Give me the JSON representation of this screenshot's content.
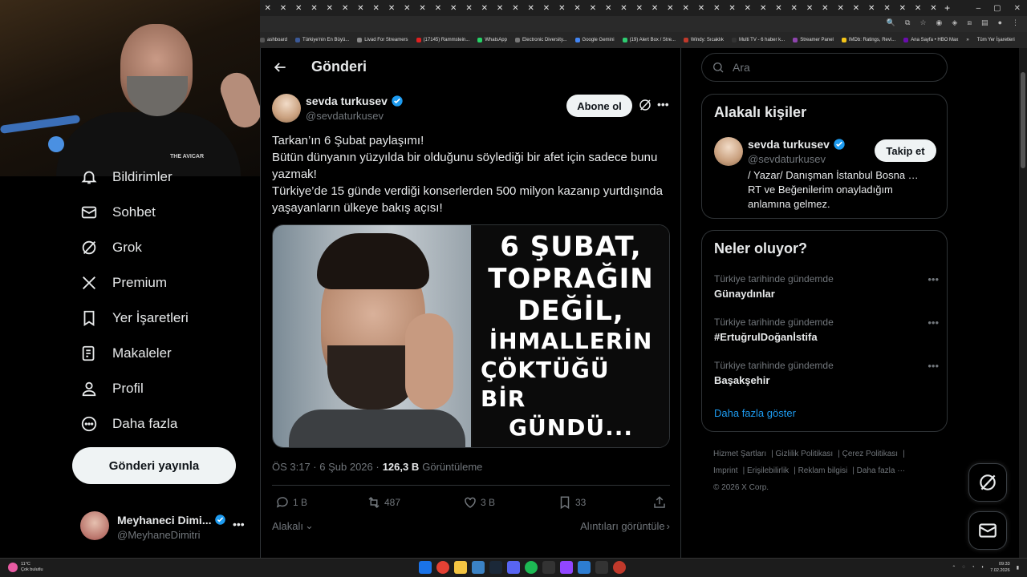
{
  "browser": {
    "bookmarks": [
      {
        "label": "ashboard",
        "color": "#555555"
      },
      {
        "label": "Türkiye'nin En Büyü...",
        "color": "#3b5998"
      },
      {
        "label": "Livad For Streamers",
        "color": "#888888"
      },
      {
        "label": "(17145) Rammstein...",
        "color": "#e02020"
      },
      {
        "label": "WhatsApp",
        "color": "#25d366"
      },
      {
        "label": "Electronic Diversity...",
        "color": "#777777"
      },
      {
        "label": "Google Gemini",
        "color": "#4285f4"
      },
      {
        "label": "(19) Alert Box / Stre...",
        "color": "#2ecc71"
      },
      {
        "label": "Windy: Sıcaklık",
        "color": "#c0392b"
      },
      {
        "label": "Multi TV - 6 haber k...",
        "color": "#333333"
      },
      {
        "label": "Streamer Panel",
        "color": "#8e44ad"
      },
      {
        "label": "IMDb: Ratings, Revi...",
        "color": "#f5c518"
      },
      {
        "label": "Ana Sayfa • HBO Max",
        "color": "#6a0dad"
      }
    ],
    "bookmarks_overflow": "»",
    "all_bookmarks": "Tüm Yer İşaretleri"
  },
  "webcam": {
    "logo_text": "THE AVICAR"
  },
  "sidebar": {
    "items": [
      {
        "label": "Bildirimler",
        "icon": "bell-icon"
      },
      {
        "label": "Sohbet",
        "icon": "mail-icon"
      },
      {
        "label": "Grok",
        "icon": "grok-icon"
      },
      {
        "label": "Premium",
        "icon": "x-logo-icon"
      },
      {
        "label": "Yer İşaretleri",
        "icon": "bookmark-icon"
      },
      {
        "label": "Makaleler",
        "icon": "article-icon"
      },
      {
        "label": "Profil",
        "icon": "person-icon"
      },
      {
        "label": "Daha fazla",
        "icon": "more-circle-icon"
      }
    ],
    "post_button": "Gönderi yayınla",
    "account": {
      "name": "Meyhaneci Dimi...",
      "handle": "@MeyhaneDimitri"
    }
  },
  "main": {
    "title": "Gönderi",
    "author": {
      "name": "sevda turkusev",
      "handle": "@sevdaturkusev"
    },
    "subscribe": "Abone ol",
    "text": [
      "Tarkan’ın 6 Şubat paylaşımı!",
      "Bütün dünyanın yüzyılda bir olduğunu söylediği bir afet için sadece bunu yazmak!",
      "Türkiye’de 15 günde verdiği konserlerden 500 milyon kazanıp yurtdışında yaşayanların ülkeye bakış açısı!"
    ],
    "media_art": [
      "6 ŞUBAT,",
      "TOPRAĞIN",
      "DEĞİL,",
      "İHMALLERİN",
      "ÇÖKTÜĞÜ BİR",
      "GÜNDÜ..."
    ],
    "time": "ÖS 3:17 · 6 Şub 2026 ·",
    "views": "126,3 B",
    "views_label": "Görüntüleme",
    "actions": {
      "replies": "1 B",
      "reposts": "487",
      "likes": "3 B",
      "bookmarks": "33"
    },
    "relevant": "Alakalı",
    "quotes": "Alıntıları görüntüle"
  },
  "right": {
    "search_placeholder": "Ara",
    "related_title": "Alakalı kişiler",
    "related": {
      "name": "sevda turkusev",
      "handle": "@sevdaturkusev",
      "follow": "Takip et",
      "bio": "/ Yazar/ Danışman İstanbul Bosna … RT ve Beğenilerim onayladığım anlamına gelmez."
    },
    "trends_title": "Neler oluyor?",
    "trends": [
      {
        "context": "Türkiye tarihinde gündemde",
        "name": "Günaydınlar"
      },
      {
        "context": "Türkiye tarihinde gündemde",
        "name": "#ErtuğrulDoğanİstifa"
      },
      {
        "context": "Türkiye tarihinde gündemde",
        "name": "Başakşehir"
      }
    ],
    "show_more": "Daha fazla göster",
    "legal": [
      "Hizmet Şartları",
      "Gizlilik Politikası",
      "Çerez Politikası",
      "Imprint",
      "Erişilebilirlik",
      "Reklam bilgisi",
      "Daha fazla ···",
      "© 2026 X Corp."
    ]
  },
  "taskbar": {
    "temp": "11°C",
    "weather": "Çok bulutlu",
    "time": "09:33",
    "date": "7.02.2026"
  },
  "colors": {
    "accent": "#1d9bf0",
    "verified": "#1d9bf0",
    "bg": "#000000"
  }
}
